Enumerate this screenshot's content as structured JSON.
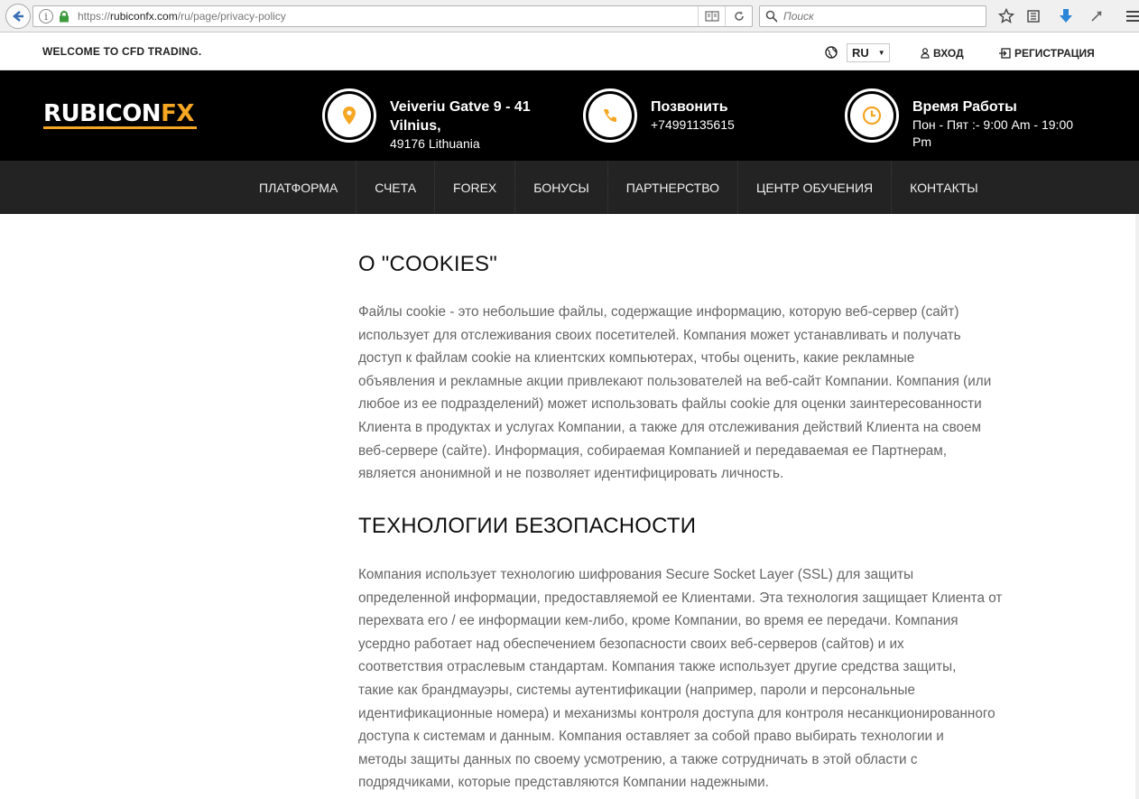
{
  "browser": {
    "url_prefix": "https://",
    "url_host": "rubiconfx.com",
    "url_path": "/ru/page/privacy-policy",
    "search_placeholder": "Поиск"
  },
  "topbar": {
    "welcome": "WELCOME TO CFD TRADING.",
    "language": "RU",
    "login": "ВХОД",
    "register": "РЕГИСТРАЦИЯ"
  },
  "header": {
    "logo": {
      "part1": "RUBICON",
      "part2": "FX"
    },
    "address": {
      "line1": "Veiveriu Gatve 9 - 41",
      "line2": "Vilnius,",
      "line3": "49176 Lithuania"
    },
    "call": {
      "title": "Позвонить",
      "phone": "+74991135615"
    },
    "hours": {
      "title": "Время Работы",
      "line1": "Пон - Пят :- 9:00 Am - 19:00",
      "line2": "Pm"
    }
  },
  "nav": {
    "items": [
      "ПЛАТФОРМА",
      "СЧЕТА",
      "FOREX",
      "БОНУСЫ",
      "ПАРТНЕРСТВО",
      "ЦЕНТР ОБУЧЕНИЯ",
      "КОНТАКТЫ"
    ]
  },
  "content": {
    "cookies_title": "О \"COOKIES\"",
    "cookies_lines": [
      "Файлы cookie - это небольшие файлы, содержащие информацию, которую веб-сервер (сайт)",
      "использует для отслеживания своих посетителей. Компания может устанавливать и получать",
      "доступ к файлам cookie на клиентских компьютерах, чтобы оценить, какие рекламные",
      "объявления и рекламные акции привлекают пользователей на веб-сайт Компании. Компания (или",
      "любое из ее подразделений) может использовать файлы cookie для оценки заинтересованности",
      "Клиента в продуктах и услугах Компании, а также для отслеживания действий Клиента на своем",
      "веб-сервере (сайте). Информация, собираемая Компанией и передаваемая ее Партнерам,",
      "является анонимной и не позволяет идентифицировать личность."
    ],
    "security_title": "ТЕХНОЛОГИИ БЕЗОПАСНОСТИ",
    "security_lines": [
      "Компания использует технологию шифрования Secure Socket Layer (SSL) для защиты",
      "определенной информации, предоставляемой ее Клиентами. Эта технология защищает Клиента от",
      "перехвата его / ее информации кем-либо, кроме Компании, во время ее передачи. Компания",
      "усердно работает над обеспечением безопасности своих веб-серверов (сайтов) и их",
      "соответствия отраслевым стандартам. Компания также использует другие средства защиты,",
      "такие как брандмауэры, системы аутентификации (например, пароли и персональные",
      "идентификационные номера) и механизмы контроля доступа для контроля несанкционированного",
      "доступа к системам и данным. Компания оставляет за собой право выбирать технологии и",
      "методы защиты данных по своему усмотрению, а также сотрудничать в этой области с",
      "подрядчиками, которые представляются Компании надежными."
    ]
  },
  "colors": {
    "accent": "#f5a623",
    "header_bg": "#000000",
    "nav_bg": "#232323",
    "text": "#666666"
  }
}
